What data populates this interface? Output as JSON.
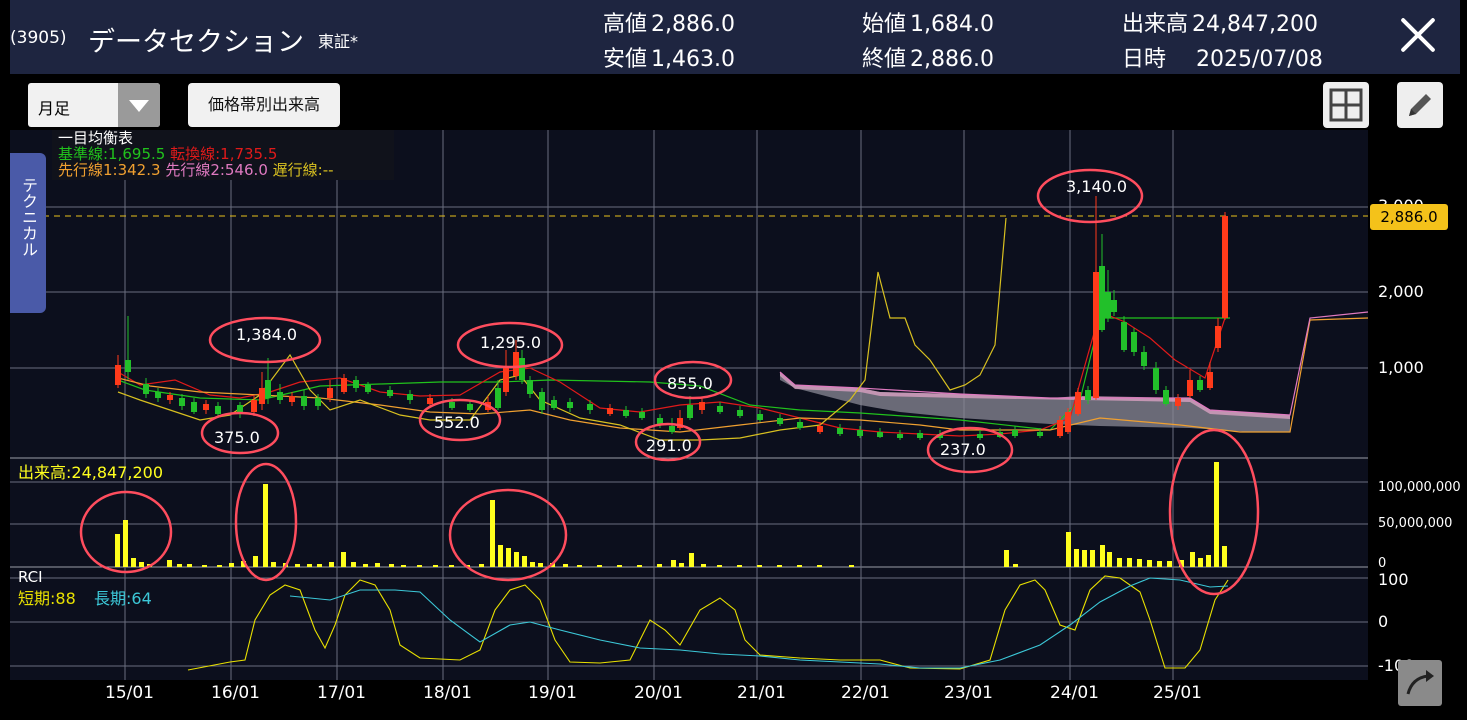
{
  "header": {
    "code": "(3905)",
    "name": "データセクション",
    "exchange": "東証*",
    "high_label": "高値",
    "high_value": "2,886.0",
    "low_label": "安値",
    "low_value": "1,463.0",
    "open_label": "始値",
    "open_value": "1,684.0",
    "close_label": "終値",
    "close_value": "2,886.0",
    "volume_label": "出来高",
    "volume_value": "24,847,200",
    "date_label": "日時",
    "date_value": "2025/07/08"
  },
  "toolbar": {
    "period_value": "月足",
    "volume_by_price_label": "価格帯別出来高"
  },
  "side_tab": "テクニカル",
  "ichimoku": {
    "title": "一目均衡表",
    "kijun": "基準線:1,695.5",
    "tenkan": "転換線:1,735.5",
    "senkou1": "先行線1:342.3",
    "senkou2": "先行線2:546.0",
    "chikou": "遅行線:--"
  },
  "annotations": [
    "1,384.0",
    "375.0",
    "1,295.0",
    "552.0",
    "855.0",
    "291.0",
    "3,140.0",
    "237.0"
  ],
  "price_axis": [
    "3,000",
    "2,000",
    "1,000"
  ],
  "price_tag": "2,886.0",
  "volume": {
    "label": "出来高:24,847,200",
    "axis": [
      "100,000,000",
      "50,000,000",
      "0"
    ]
  },
  "rci": {
    "title": "RCI",
    "short": "短期:88",
    "long": "長期:64",
    "axis": [
      "100",
      "0",
      "-100"
    ]
  },
  "x_labels": [
    "15/01",
    "16/01",
    "17/01",
    "18/01",
    "19/01",
    "20/01",
    "21/01",
    "22/01",
    "23/01",
    "24/01",
    "25/01"
  ],
  "colors": {
    "header_bg": "#1e2540",
    "up_candle": "#22c02a",
    "down_candle": "#ff3a1a",
    "volume_bar": "#ffff1e",
    "rci_short": "#e8e000",
    "rci_long": "#3cc8d8",
    "kijun": "#21c21c",
    "tenkan": "#e01a1a",
    "senkou1": "#f0a030",
    "senkou2": "#e07ac0",
    "marker_circle": "#ff4d5e",
    "price_tag": "#f4c21a"
  },
  "icons": [
    "grid-icon",
    "pencil-icon",
    "close-icon",
    "chevron-down-icon",
    "reset-icon"
  ]
}
